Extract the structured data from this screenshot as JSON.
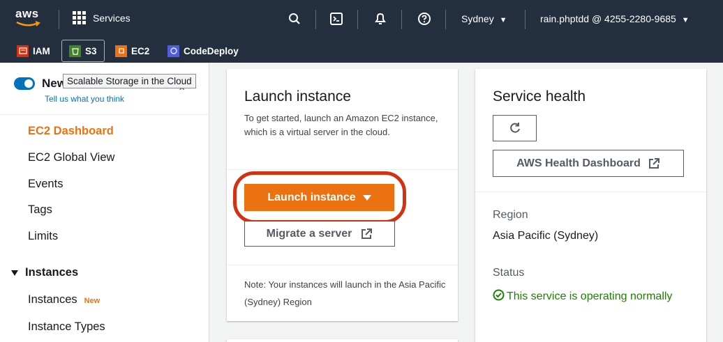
{
  "topbar": {
    "logo_text": "aws",
    "services_label": "Services",
    "region_label": "Sydney",
    "account_label": "rain.phptdd @ 4255-2280-9685",
    "icons": [
      "search-icon",
      "cloudshell-icon",
      "bell-icon",
      "help-icon"
    ]
  },
  "favorites": [
    {
      "label": "IAM",
      "color": "#d13212"
    },
    {
      "label": "S3",
      "color": "#3f8624"
    },
    {
      "label": "EC2",
      "color": "#ec7211"
    },
    {
      "label": "CodeDeploy",
      "color": "#4d5fe0"
    }
  ],
  "sidebar": {
    "new_toggle_label": "New",
    "feedback_link": "Tell us what you think",
    "tooltip": "Scalable Storage in the Cloud",
    "items": [
      {
        "label": "EC2 Dashboard"
      },
      {
        "label": "EC2 Global View"
      },
      {
        "label": "Events"
      },
      {
        "label": "Tags"
      },
      {
        "label": "Limits"
      }
    ],
    "section_label": "Instances",
    "sub_items": [
      {
        "label": "Instances",
        "badge": "New"
      },
      {
        "label": "Instance Types"
      }
    ]
  },
  "launch_card": {
    "title": "Launch instance",
    "description": "To get started, launch an Amazon EC2 instance, which is a virtual server in the cloud.",
    "primary_button": "Launch instance",
    "secondary_button": "Migrate a server",
    "note": "Note: Your instances will launch in the Asia Pacific (Sydney) Region"
  },
  "health_card": {
    "title": "Service health",
    "dashboard_button": "AWS Health Dashboard",
    "region_label": "Region",
    "region_value": "Asia Pacific (Sydney)",
    "status_label": "Status",
    "status_value": "This service is operating normally",
    "status_color": "#1d8102"
  },
  "colors": {
    "accent": "#ec7211",
    "nav_bg": "#232f3e",
    "highlight": "#d13212",
    "link": "#0073bb"
  }
}
